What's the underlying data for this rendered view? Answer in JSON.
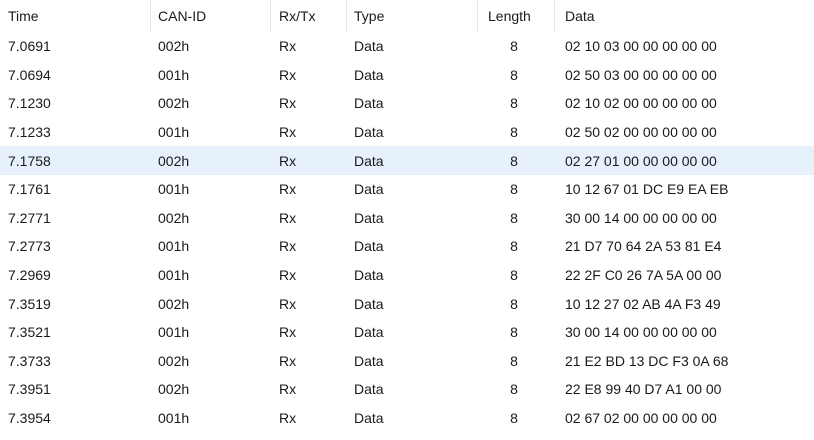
{
  "columns": {
    "time": "Time",
    "can_id": "CAN-ID",
    "rx_tx": "Rx/Tx",
    "type": "Type",
    "length": "Length",
    "data": "Data"
  },
  "selected_row_index": 4,
  "rows": [
    {
      "time": "7.0691",
      "can_id": "002h",
      "rx_tx": "Rx",
      "type": "Data",
      "length": "8",
      "data": "02 10 03 00 00 00 00 00"
    },
    {
      "time": "7.0694",
      "can_id": "001h",
      "rx_tx": "Rx",
      "type": "Data",
      "length": "8",
      "data": "02 50 03 00 00 00 00 00"
    },
    {
      "time": "7.1230",
      "can_id": "002h",
      "rx_tx": "Rx",
      "type": "Data",
      "length": "8",
      "data": "02 10 02 00 00 00 00 00"
    },
    {
      "time": "7.1233",
      "can_id": "001h",
      "rx_tx": "Rx",
      "type": "Data",
      "length": "8",
      "data": "02 50 02 00 00 00 00 00"
    },
    {
      "time": "7.1758",
      "can_id": "002h",
      "rx_tx": "Rx",
      "type": "Data",
      "length": "8",
      "data": "02 27 01 00 00 00 00 00"
    },
    {
      "time": "7.1761",
      "can_id": "001h",
      "rx_tx": "Rx",
      "type": "Data",
      "length": "8",
      "data": "10 12 67 01 DC E9 EA EB"
    },
    {
      "time": "7.2771",
      "can_id": "002h",
      "rx_tx": "Rx",
      "type": "Data",
      "length": "8",
      "data": "30 00 14 00 00 00 00 00"
    },
    {
      "time": "7.2773",
      "can_id": "001h",
      "rx_tx": "Rx",
      "type": "Data",
      "length": "8",
      "data": "21 D7 70 64 2A 53 81 E4"
    },
    {
      "time": "7.2969",
      "can_id": "001h",
      "rx_tx": "Rx",
      "type": "Data",
      "length": "8",
      "data": "22 2F C0 26 7A 5A 00 00"
    },
    {
      "time": "7.3519",
      "can_id": "002h",
      "rx_tx": "Rx",
      "type": "Data",
      "length": "8",
      "data": "10 12 27 02 AB 4A F3 49"
    },
    {
      "time": "7.3521",
      "can_id": "001h",
      "rx_tx": "Rx",
      "type": "Data",
      "length": "8",
      "data": "30 00 14 00 00 00 00 00"
    },
    {
      "time": "7.3733",
      "can_id": "002h",
      "rx_tx": "Rx",
      "type": "Data",
      "length": "8",
      "data": "21 E2 BD 13 DC F3 0A 68"
    },
    {
      "time": "7.3951",
      "can_id": "002h",
      "rx_tx": "Rx",
      "type": "Data",
      "length": "8",
      "data": "22 E8 99 40 D7 A1 00 00"
    },
    {
      "time": "7.3954",
      "can_id": "001h",
      "rx_tx": "Rx",
      "type": "Data",
      "length": "8",
      "data": "02 67 02 00 00 00 00 00"
    }
  ]
}
